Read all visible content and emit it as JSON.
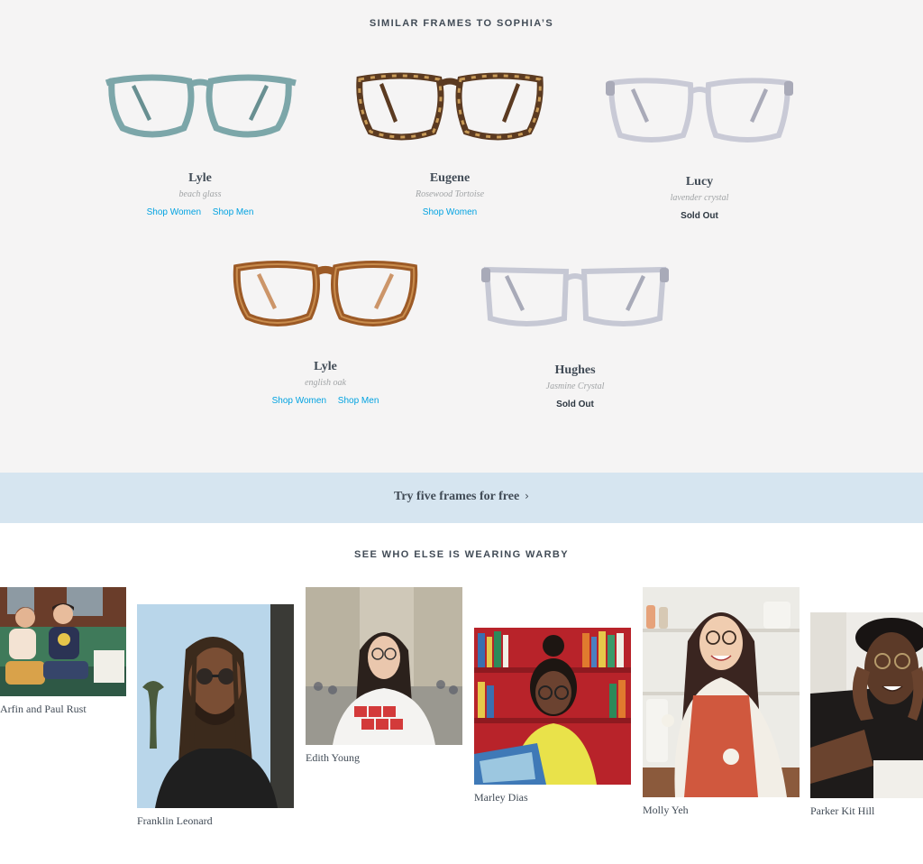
{
  "similar": {
    "heading": "SIMILAR FRAMES TO SOPHIA’S",
    "frames": [
      {
        "name": "Lyle",
        "color_name": "beach glass",
        "frame_hex": "#6f9ea1",
        "shop_women": "Shop Women",
        "shop_men": "Shop Men"
      },
      {
        "name": "Eugene",
        "color_name": "Rosewood Tortoise",
        "frame_hex": "#5b3a21",
        "shop_women": "Shop Women"
      },
      {
        "name": "Lucy",
        "color_name": "lavender crystal",
        "frame_hex": "#c9cad6",
        "sold_out": "Sold Out"
      },
      {
        "name": "Lyle",
        "color_name": "english oak",
        "frame_hex": "#9c5a26",
        "shop_women": "Shop Women",
        "shop_men": "Shop Men"
      },
      {
        "name": "Hughes",
        "color_name": "Jasmine Crystal",
        "frame_hex": "#c6c8d4",
        "sold_out": "Sold Out"
      }
    ]
  },
  "banner": {
    "label": "Try five frames for free",
    "chevron": "›"
  },
  "customers": {
    "heading": "SEE WHO ELSE IS WEARING WARBY",
    "people": [
      {
        "name": "Arfin and Paul Rust"
      },
      {
        "name": "Franklin Leonard"
      },
      {
        "name": "Edith Young"
      },
      {
        "name": "Marley Dias"
      },
      {
        "name": "Molly Yeh"
      },
      {
        "name": "Parker Kit Hill"
      }
    ]
  },
  "colors": {
    "link": "#00a2e1",
    "text": "#414b56",
    "banner_bg": "#d6e5f0",
    "section_bg": "#f5f4f4"
  }
}
